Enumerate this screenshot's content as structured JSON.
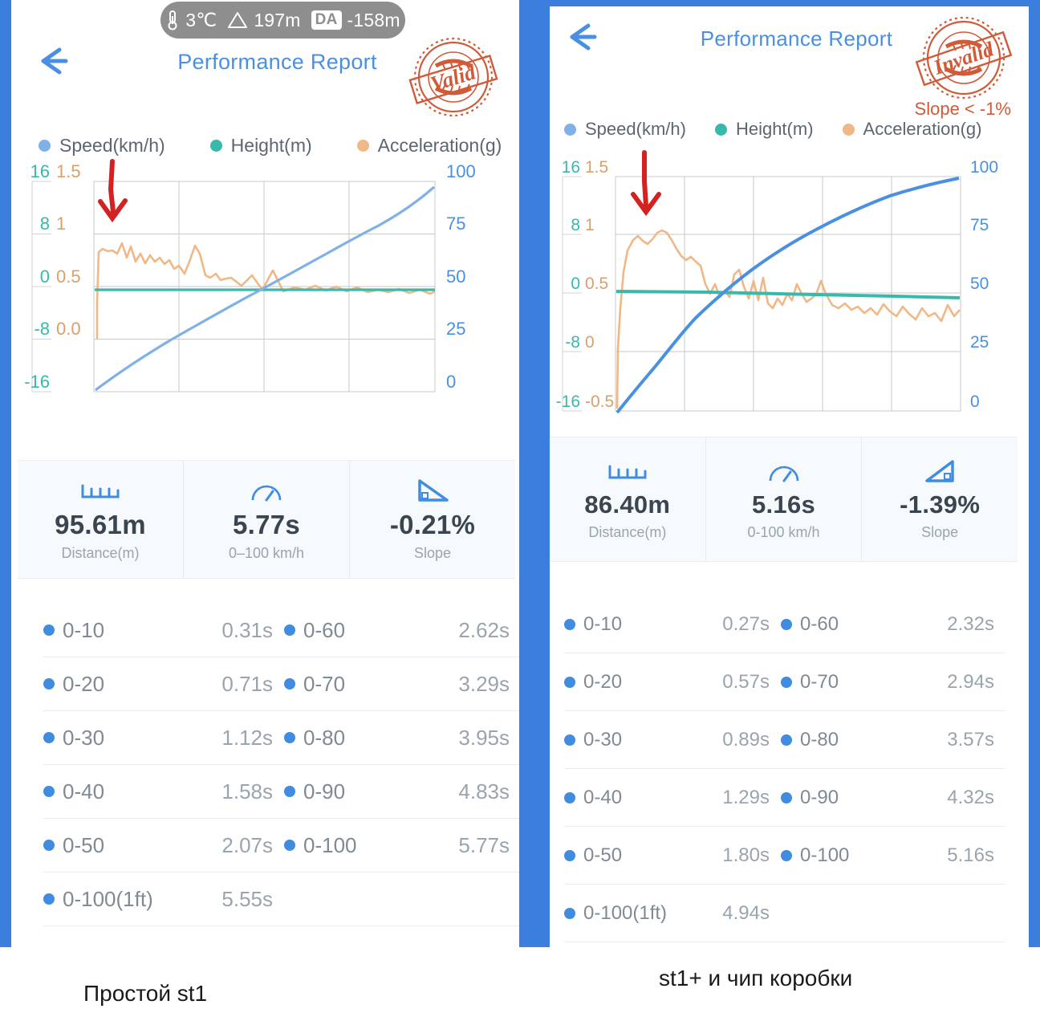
{
  "theme": {
    "brand_blue": "#3b7edd",
    "title_blue": "#4a90e2",
    "speed_blue": "#7fb1e8",
    "height_teal": "#38b9ac",
    "accel_orange": "#f0b887",
    "stamp_orange": "#cf5b39",
    "arrow_red": "#d42222",
    "stat_bg": "#f6fafd"
  },
  "left": {
    "status_bar": {
      "temperature": "3℃",
      "altitude": "197m",
      "da_label": "DA",
      "da_value": "-158m",
      "thermometer_icon": "thermometer-icon",
      "mountain_icon": "mountain-icon"
    },
    "header": {
      "back_icon": "back-arrow-icon",
      "title": "Performance Report",
      "stamp_text": "Valid",
      "stamp_icon": "valid-stamp-icon"
    },
    "legend": [
      {
        "label": "Speed(km/h)",
        "color": "#7fb1e8"
      },
      {
        "label": "Height(m)",
        "color": "#38b9ac"
      },
      {
        "label": "Acceleration(g)",
        "color": "#f0b887"
      }
    ],
    "stats": [
      {
        "icon": "ruler-icon",
        "value": "95.61m",
        "label": "Distance(m)"
      },
      {
        "icon": "speedometer-icon",
        "value": "5.77s",
        "label": "0–100 km/h"
      },
      {
        "icon": "slope-icon",
        "value": "-0.21%",
        "label": "Slope"
      }
    ],
    "timings": [
      {
        "l_label": "0-10",
        "l_value": "0.31s",
        "r_label": "0-60",
        "r_value": "2.62s"
      },
      {
        "l_label": "0-20",
        "l_value": "0.71s",
        "r_label": "0-70",
        "r_value": "3.29s"
      },
      {
        "l_label": "0-30",
        "l_value": "1.12s",
        "r_label": "0-80",
        "r_value": "3.95s"
      },
      {
        "l_label": "0-40",
        "l_value": "1.58s",
        "r_label": "0-90",
        "r_value": "4.83s"
      },
      {
        "l_label": "0-50",
        "l_value": "2.07s",
        "r_label": "0-100",
        "r_value": "5.77s"
      },
      {
        "l_label": "0-100(1ft)",
        "l_value": "5.55s",
        "r_label": "",
        "r_value": ""
      }
    ],
    "caption": "Простой st1"
  },
  "right": {
    "header": {
      "back_icon": "back-arrow-icon",
      "title": "Performance Report",
      "stamp_text": "Invalid",
      "stamp_icon": "invalid-stamp-icon",
      "stamp_note": "Slope < -1%"
    },
    "legend": [
      {
        "label": "Speed(km/h)",
        "color": "#7fb1e8"
      },
      {
        "label": "Height(m)",
        "color": "#38b9ac"
      },
      {
        "label": "Acceleration(g)",
        "color": "#f0b887"
      }
    ],
    "stats": [
      {
        "icon": "ruler-icon",
        "value": "86.40m",
        "label": "Distance(m)"
      },
      {
        "icon": "speedometer-icon",
        "value": "5.16s",
        "label": "0-100 km/h"
      },
      {
        "icon": "slope-up-icon",
        "value": "-1.39%",
        "label": "Slope"
      }
    ],
    "timings": [
      {
        "l_label": "0-10",
        "l_value": "0.27s",
        "r_label": "0-60",
        "r_value": "2.32s"
      },
      {
        "l_label": "0-20",
        "l_value": "0.57s",
        "r_label": "0-70",
        "r_value": "2.94s"
      },
      {
        "l_label": "0-30",
        "l_value": "0.89s",
        "r_label": "0-80",
        "r_value": "3.57s"
      },
      {
        "l_label": "0-40",
        "l_value": "1.29s",
        "r_label": "0-90",
        "r_value": "4.32s"
      },
      {
        "l_label": "0-50",
        "l_value": "1.80s",
        "r_label": "0-100",
        "r_value": "5.16s"
      },
      {
        "l_label": "0-100(1ft)",
        "l_value": "4.94s",
        "r_label": "",
        "r_value": ""
      }
    ],
    "caption": "st1+  и чип коробки"
  },
  "chart_data": [
    {
      "id": "left-chart",
      "type": "line",
      "title": "Performance Report",
      "xlabel": "",
      "grid": true,
      "legend_position": "above-top-left",
      "axes": {
        "left_outer": {
          "name": "Height(m)",
          "color": "#38b9ac",
          "ticks": [
            16,
            8,
            0,
            -8,
            -16
          ],
          "range": [
            -16,
            16
          ]
        },
        "left_inner": {
          "name": "Acceleration(g)",
          "color": "#d9a06a",
          "ticks": [
            "1.5",
            "1",
            "0.5",
            "0.0"
          ],
          "range": [
            -0.5,
            1.5
          ]
        },
        "right": {
          "name": "Speed(km/h)",
          "color": "#4a90e2",
          "ticks": [
            100,
            75,
            50,
            25,
            0
          ],
          "range": [
            0,
            100
          ]
        }
      },
      "series": [
        {
          "name": "Speed(km/h)",
          "color": "#7fb1e8",
          "axis": "right",
          "x": [
            0,
            0.05,
            0.1,
            0.15,
            0.2,
            0.25,
            0.3,
            0.35,
            0.4,
            0.45,
            0.5,
            0.55,
            0.6,
            0.65,
            0.7,
            0.75,
            0.8,
            0.85,
            0.9,
            0.95,
            1
          ],
          "values": [
            0,
            7,
            14,
            20,
            26,
            31,
            36,
            41,
            45,
            49,
            53,
            57,
            61,
            65,
            69,
            74,
            79,
            84,
            88,
            93,
            99
          ]
        },
        {
          "name": "Height(m)",
          "color": "#38b9ac",
          "axis": "left_outer",
          "x": [
            0,
            0.1,
            0.2,
            0.3,
            0.4,
            0.5,
            0.6,
            0.7,
            0.8,
            0.9,
            1
          ],
          "values": [
            -0.3,
            -0.3,
            -0.3,
            -0.3,
            -0.3,
            -0.3,
            -0.3,
            -0.3,
            -0.3,
            -0.3,
            -0.3
          ]
        },
        {
          "name": "Acceleration(g)",
          "color": "#f0b887",
          "axis": "left_inner",
          "x": [
            0,
            0.01,
            0.03,
            0.05,
            0.07,
            0.09,
            0.11,
            0.13,
            0.15,
            0.17,
            0.19,
            0.21,
            0.23,
            0.25,
            0.27,
            0.29,
            0.31,
            0.33,
            0.35,
            0.37,
            0.39,
            0.41,
            0.43,
            0.45,
            0.47,
            0.49,
            0.51,
            0.53,
            0.55,
            0.57,
            0.6,
            0.63,
            0.66,
            0.69,
            0.72,
            0.75,
            0.78,
            0.81,
            0.84,
            0.87,
            0.9,
            0.93,
            0.96,
            1
          ],
          "values": [
            0.0,
            0.45,
            0.78,
            0.74,
            0.76,
            0.75,
            0.72,
            0.84,
            0.68,
            0.79,
            0.64,
            0.72,
            0.62,
            0.7,
            0.63,
            0.67,
            0.6,
            0.64,
            0.55,
            0.58,
            0.5,
            0.62,
            0.8,
            0.72,
            0.5,
            0.48,
            0.52,
            0.45,
            0.46,
            0.47,
            0.38,
            0.5,
            0.35,
            0.55,
            0.33,
            0.37,
            0.35,
            0.39,
            0.34,
            0.38,
            0.33,
            0.37,
            0.32,
            0.34
          ]
        }
      ],
      "annotation": {
        "type": "arrow",
        "color": "#d42222",
        "points_to": "acceleration-initial-peak"
      }
    },
    {
      "id": "right-chart",
      "type": "line",
      "title": "Performance Report",
      "xlabel": "",
      "grid": true,
      "legend_position": "above-top-left",
      "axes": {
        "left_outer": {
          "name": "Height(m)",
          "color": "#38b9ac",
          "ticks": [
            16,
            8,
            0,
            -8,
            -16
          ],
          "range": [
            -16,
            16
          ]
        },
        "left_inner": {
          "name": "Acceleration(g)",
          "color": "#d9a06a",
          "ticks": [
            "1.5",
            "1",
            "0.5",
            "0",
            "-0.5"
          ],
          "range": [
            -0.5,
            1.5
          ]
        },
        "right": {
          "name": "Speed(km/h)",
          "color": "#4a90e2",
          "ticks": [
            100,
            75,
            50,
            25,
            0
          ],
          "range": [
            0,
            100
          ]
        }
      },
      "series": [
        {
          "name": "Speed(km/h)",
          "color": "#4a90e2",
          "axis": "right",
          "x": [
            0,
            0.05,
            0.1,
            0.15,
            0.2,
            0.25,
            0.3,
            0.35,
            0.4,
            0.45,
            0.5,
            0.55,
            0.6,
            0.65,
            0.7,
            0.75,
            0.8,
            0.85,
            0.9,
            0.95,
            1
          ],
          "values": [
            -2,
            8,
            17,
            24,
            30,
            36,
            41,
            46,
            51,
            56,
            60,
            65,
            70,
            75,
            79,
            83,
            87,
            90,
            93,
            96,
            99
          ]
        },
        {
          "name": "Height(m)",
          "color": "#38b9ac",
          "axis": "left_outer",
          "x": [
            0,
            0.1,
            0.2,
            0.3,
            0.4,
            0.5,
            0.6,
            0.7,
            0.8,
            0.9,
            1
          ],
          "values": [
            0.2,
            0.2,
            0.1,
            0.0,
            -0.1,
            -0.2,
            -0.3,
            -0.4,
            -0.5,
            -0.6,
            -0.7
          ]
        },
        {
          "name": "Acceleration(g)",
          "color": "#f0b887",
          "axis": "left_inner",
          "x": [
            0,
            0.01,
            0.02,
            0.04,
            0.06,
            0.08,
            0.1,
            0.12,
            0.14,
            0.16,
            0.18,
            0.2,
            0.22,
            0.24,
            0.26,
            0.28,
            0.3,
            0.32,
            0.34,
            0.36,
            0.38,
            0.4,
            0.42,
            0.44,
            0.46,
            0.48,
            0.5,
            0.52,
            0.54,
            0.56,
            0.58,
            0.6,
            0.62,
            0.64,
            0.66,
            0.68,
            0.7,
            0.72,
            0.74,
            0.76,
            0.78,
            0.8,
            0.82,
            0.84,
            0.86,
            0.88,
            0.9,
            0.92,
            0.94,
            0.96,
            0.98,
            1
          ],
          "values": [
            -0.5,
            0.1,
            0.45,
            0.72,
            0.88,
            0.92,
            0.86,
            0.84,
            0.9,
            0.96,
            0.93,
            0.86,
            0.78,
            0.72,
            0.7,
            0.72,
            0.68,
            0.66,
            0.5,
            0.44,
            0.52,
            0.42,
            0.48,
            0.44,
            0.62,
            0.66,
            0.52,
            0.44,
            0.56,
            0.4,
            0.58,
            0.42,
            0.36,
            0.46,
            0.4,
            0.38,
            0.52,
            0.44,
            0.4,
            0.46,
            0.58,
            0.44,
            0.36,
            0.34,
            0.38,
            0.36,
            0.42,
            0.35,
            0.3,
            0.45,
            0.33,
            0.38
          ]
        }
      ],
      "annotation": {
        "type": "arrow",
        "color": "#d42222",
        "points_to": "acceleration-initial-peak"
      }
    }
  ]
}
